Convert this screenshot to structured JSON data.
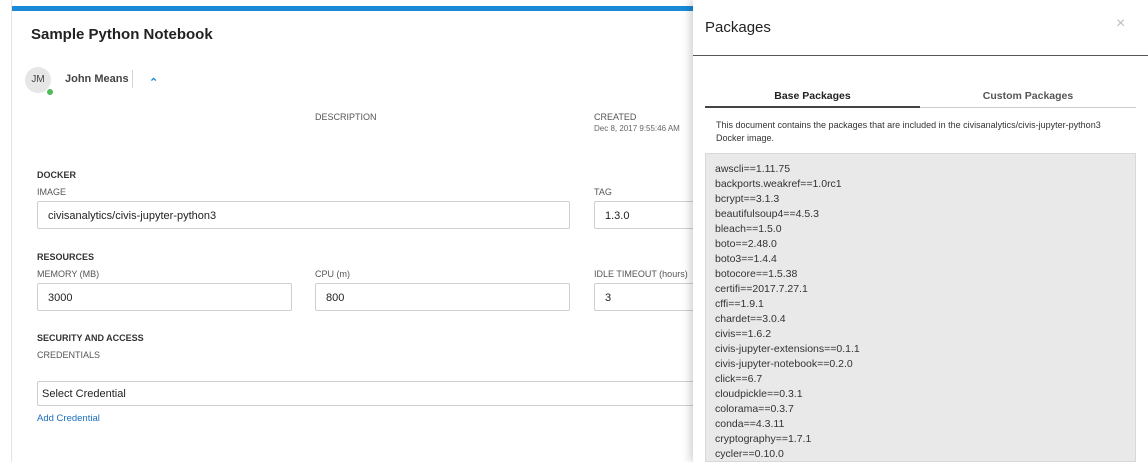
{
  "notebook": {
    "title": "Sample Python Notebook",
    "owner_initials": "JM",
    "owner_name": "John Means",
    "description_label": "DESCRIPTION",
    "created_label": "CREATED",
    "created_value": "Dec 8, 2017 9:55:46 AM",
    "docker": {
      "section": "DOCKER",
      "image_label": "IMAGE",
      "image_value": "civisanalytics/civis-jupyter-python3",
      "tag_label": "TAG",
      "tag_value": "1.3.0"
    },
    "resources": {
      "section": "RESOURCES",
      "memory_label": "MEMORY (MB)",
      "memory_value": "3000",
      "cpu_label": "CPU (m)",
      "cpu_value": "800",
      "idle_label": "IDLE TIMEOUT (hours)",
      "idle_value": "3"
    },
    "security": {
      "section": "SECURITY AND ACCESS",
      "credentials_label": "CREDENTIALS",
      "select_placeholder": "Select Credential",
      "add_link": "Add Credential"
    }
  },
  "packages_drawer": {
    "title": "Packages",
    "close_icon": "×",
    "tabs": {
      "base": "Base Packages",
      "custom": "Custom Packages"
    },
    "description": "This document contains the packages that are included in the civisanalytics/civis-jupyter-python3 Docker image.",
    "packages": [
      "awscli==1.11.75",
      "backports.weakref==1.0rc1",
      "bcrypt==3.1.3",
      "beautifulsoup4==4.5.3",
      "bleach==1.5.0",
      "boto==2.48.0",
      "boto3==1.4.4",
      "botocore==1.5.38",
      "certifi==2017.7.27.1",
      "cffi==1.9.1",
      "chardet==3.0.4",
      "civis==1.6.2",
      "civis-jupyter-extensions==0.1.1",
      "civis-jupyter-notebook==0.2.0",
      "click==6.7",
      "cloudpickle==0.3.1",
      "colorama==0.3.7",
      "conda==4.3.11",
      "cryptography==1.7.1",
      "cycler==0.10.0"
    ]
  },
  "colors": {
    "accent": "#1a8ad6",
    "online": "#4cbb5a",
    "list_bg": "#e9e9e9"
  }
}
